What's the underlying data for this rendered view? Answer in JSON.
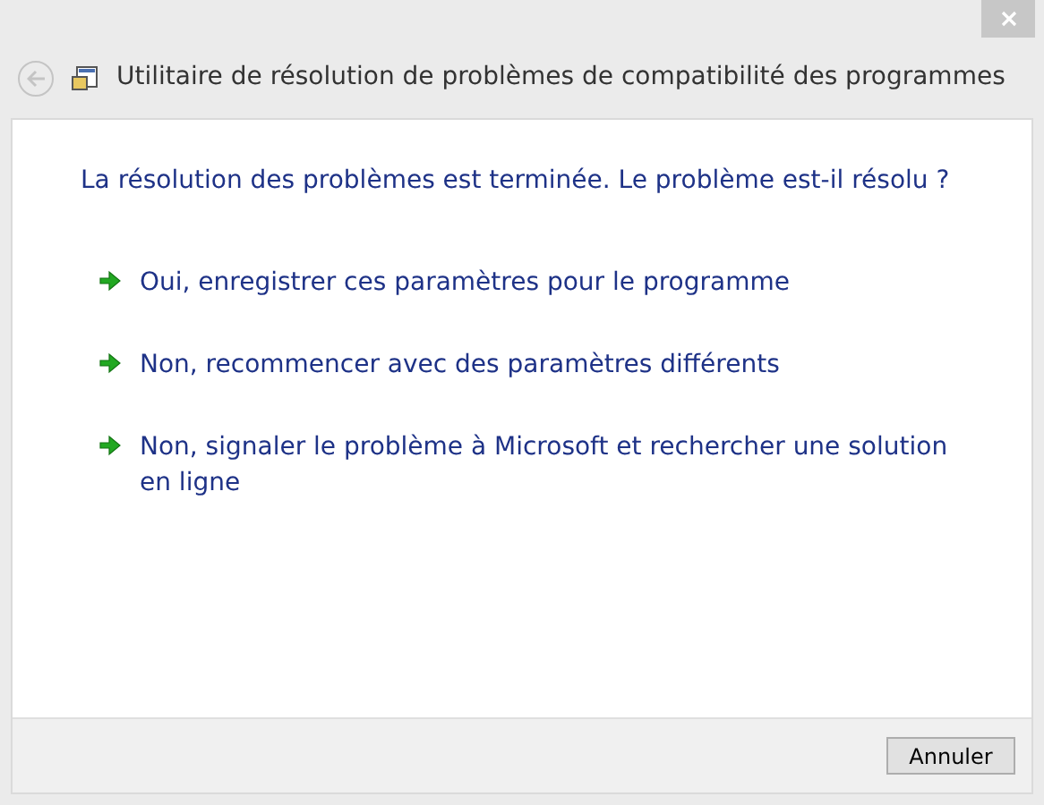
{
  "window": {
    "title": "Utilitaire de résolution de problèmes de compatibilité des programmes"
  },
  "heading": "La résolution des problèmes est terminée. Le problème est-il résolu ?",
  "options": [
    {
      "label": "Oui, enregistrer ces paramètres pour le programme"
    },
    {
      "label": "Non, recommencer avec des paramètres différents"
    },
    {
      "label": "Non, signaler le problème à Microsoft et rechercher une solution en ligne"
    }
  ],
  "buttons": [
    "Annuler"
  ]
}
